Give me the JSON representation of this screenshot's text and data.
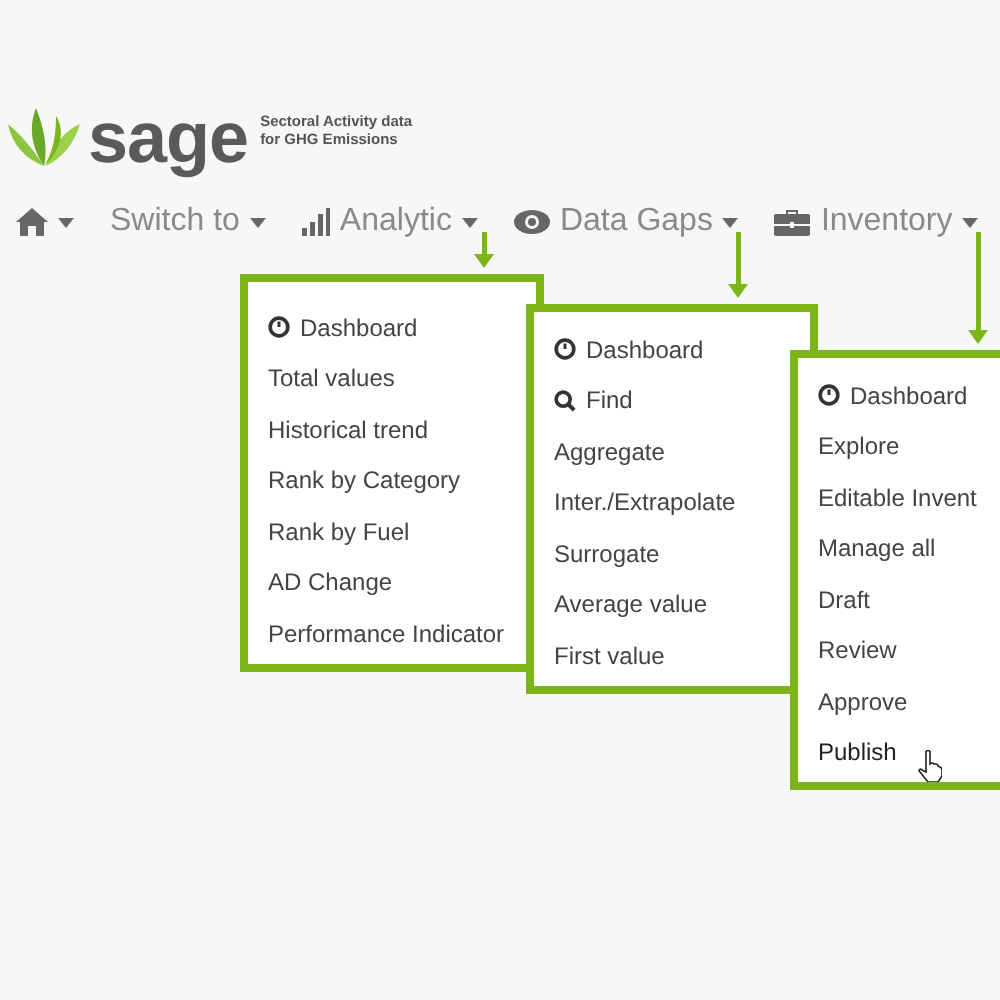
{
  "logo": {
    "name": "sage",
    "tagline": [
      "Sectoral Activity data",
      "for GHG Emissions"
    ]
  },
  "nav": [
    {
      "kind": "home"
    },
    {
      "kind": "plain",
      "label": "Switch to"
    },
    {
      "kind": "bars",
      "label": "Analytic"
    },
    {
      "kind": "eye",
      "label": "Data Gaps"
    },
    {
      "kind": "briefcase",
      "label": "Inventory"
    }
  ],
  "menus": [
    {
      "items": [
        {
          "kind": "gauge",
          "label": "Dashboard"
        },
        {
          "kind": "text",
          "label": "Total values"
        },
        {
          "kind": "text",
          "label": "Historical trend"
        },
        {
          "kind": "text",
          "label": "Rank by Category"
        },
        {
          "kind": "text",
          "label": "Rank by Fuel"
        },
        {
          "kind": "text",
          "label": "AD Change"
        },
        {
          "kind": "text",
          "label": "Performance Indicator"
        }
      ]
    },
    {
      "items": [
        {
          "kind": "gauge",
          "label": "Dashboard"
        },
        {
          "kind": "search",
          "label": "Find"
        },
        {
          "kind": "text",
          "label": "Aggregate"
        },
        {
          "kind": "text",
          "label": "Inter./Extrapolate"
        },
        {
          "kind": "text",
          "label": "Surrogate"
        },
        {
          "kind": "text",
          "label": "Average value"
        },
        {
          "kind": "text",
          "label": "First value"
        }
      ]
    },
    {
      "items": [
        {
          "kind": "gauge",
          "label": "Dashboard"
        },
        {
          "kind": "text",
          "label": "Explore"
        },
        {
          "kind": "text",
          "label": "Editable Invent"
        },
        {
          "kind": "text",
          "label": "Manage all"
        },
        {
          "kind": "text",
          "label": "Draft"
        },
        {
          "kind": "text",
          "label": "Review"
        },
        {
          "kind": "text",
          "label": "Approve"
        },
        {
          "kind": "text",
          "label": "Publish",
          "hovered": true
        }
      ]
    }
  ]
}
